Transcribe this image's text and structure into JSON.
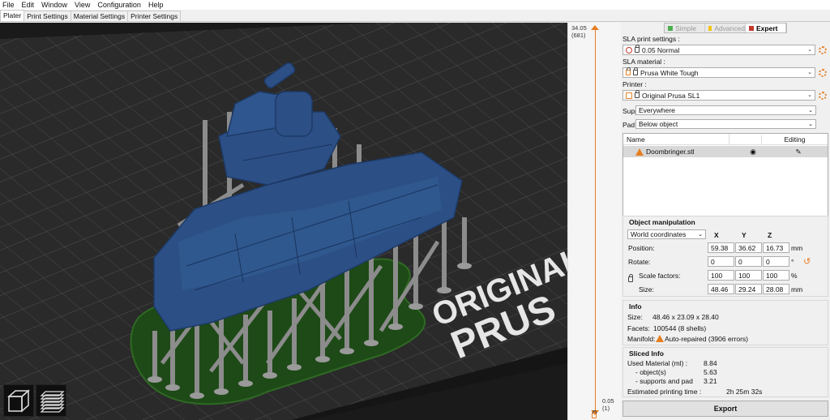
{
  "menu": [
    "File",
    "Edit",
    "Window",
    "View",
    "Configuration",
    "Help"
  ],
  "tabs": [
    "Plater",
    "Print Settings",
    "Material Settings",
    "Printer Settings"
  ],
  "viewport": {
    "bed_text_line1": "ORIGINAL",
    "bed_text_line2": "PRUS"
  },
  "layer_slider": {
    "top_height": "34.05",
    "top_layer": "(681)",
    "bottom_height": "0.05",
    "bottom_layer": "(1)"
  },
  "modes": [
    {
      "label": "Simple",
      "color": "#4caf50"
    },
    {
      "label": "Advanced",
      "color": "#f1c40f"
    },
    {
      "label": "Expert",
      "color": "#c0392b"
    }
  ],
  "settings": {
    "print_label": "SLA print settings :",
    "print_value": "0.05 Normal",
    "material_label": "SLA material :",
    "material_value": "Prusa White Tough",
    "printer_label": "Printer :",
    "printer_value": "Original Prusa SL1",
    "supports_label": "Supports:",
    "supports_value": "Everywhere",
    "pad_label": "Pad:",
    "pad_value": "Below object"
  },
  "object_list": {
    "col_name": "Name",
    "col_editing": "Editing",
    "objects": [
      {
        "name": "Doombringer.stl"
      }
    ]
  },
  "manipulation": {
    "title": "Object manipulation",
    "coord_mode": "World coordinates",
    "axis_x": "X",
    "axis_y": "Y",
    "axis_z": "Z",
    "position_label": "Position:",
    "position": [
      "59.38",
      "36.62",
      "16.73"
    ],
    "position_unit": "mm",
    "rotate_label": "Rotate:",
    "rotate": [
      "0",
      "0",
      "0"
    ],
    "rotate_unit": "°",
    "scale_label": "Scale factors:",
    "scale": [
      "100",
      "100",
      "100"
    ],
    "scale_unit": "%",
    "size_label": "Size:",
    "size": [
      "48.46",
      "29.24",
      "28.08"
    ],
    "size_unit": "mm"
  },
  "info": {
    "title": "Info",
    "size_label": "Size:",
    "size_value": "48.46 x 23.09 x 28.40",
    "facets_label": "Facets:",
    "facets_value": "100544 (8 shells)",
    "manifold_label": "Manifold:",
    "manifold_value": "Auto-repaired (3906 errors)"
  },
  "sliced": {
    "title": "Sliced Info",
    "used_label": "Used Material (ml) :",
    "used_value": "8.84",
    "objects_label": "- object(s)",
    "objects_value": "5.63",
    "supports_label": "- supports and pad",
    "supports_value": "3.21",
    "time_label": "Estimated printing time :",
    "time_value": "2h 25m 32s"
  },
  "export_label": "Export",
  "colors": {
    "accent": "#e67e22",
    "model": "#2c4f86",
    "support": "#8c8c8c",
    "pad": "#1e4a17",
    "bed": "#232323"
  }
}
